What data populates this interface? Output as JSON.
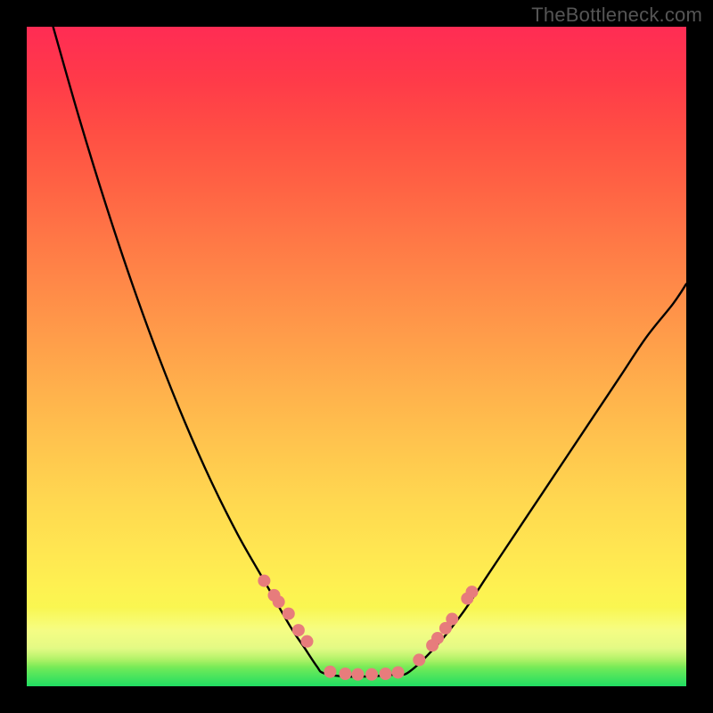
{
  "watermark": "TheBottleneck.com",
  "chart_data": {
    "type": "line",
    "title": "",
    "xlabel": "",
    "ylabel": "",
    "xlim": [
      0,
      100
    ],
    "ylim": [
      0,
      100
    ],
    "grid": false,
    "legend": false,
    "annotations": [],
    "series": [
      {
        "name": "left-curve",
        "x": [
          4,
          8,
          12,
          16,
          20,
          24,
          28,
          32,
          36,
          40,
          42,
          44,
          45
        ],
        "y": [
          100,
          86,
          73,
          61,
          50,
          40,
          31,
          23,
          16,
          9,
          6,
          3,
          2
        ]
      },
      {
        "name": "valley-floor",
        "x": [
          45,
          48,
          52,
          56,
          58
        ],
        "y": [
          2,
          1.5,
          1.5,
          1.8,
          2.2
        ]
      },
      {
        "name": "right-curve",
        "x": [
          58,
          62,
          66,
          70,
          74,
          78,
          82,
          86,
          90,
          94,
          98,
          100
        ],
        "y": [
          2.2,
          6,
          11,
          17,
          23,
          29,
          35,
          41,
          47,
          53,
          58,
          61
        ]
      }
    ],
    "markers": [
      {
        "name": "left-cluster",
        "points": [
          {
            "x": 36.0,
            "y": 16.0
          },
          {
            "x": 37.5,
            "y": 13.8
          },
          {
            "x": 38.2,
            "y": 12.8
          },
          {
            "x": 39.7,
            "y": 11.0
          },
          {
            "x": 41.2,
            "y": 8.5
          },
          {
            "x": 42.5,
            "y": 6.8
          }
        ]
      },
      {
        "name": "floor-cluster",
        "points": [
          {
            "x": 46.0,
            "y": 2.2
          },
          {
            "x": 48.3,
            "y": 1.9
          },
          {
            "x": 50.2,
            "y": 1.8
          },
          {
            "x": 52.3,
            "y": 1.8
          },
          {
            "x": 54.4,
            "y": 1.9
          },
          {
            "x": 56.3,
            "y": 2.1
          }
        ]
      },
      {
        "name": "right-cluster",
        "points": [
          {
            "x": 59.5,
            "y": 4.0
          },
          {
            "x": 61.5,
            "y": 6.2
          },
          {
            "x": 62.3,
            "y": 7.3
          },
          {
            "x": 63.5,
            "y": 8.8
          },
          {
            "x": 64.5,
            "y": 10.2
          },
          {
            "x": 66.8,
            "y": 13.3
          },
          {
            "x": 67.5,
            "y": 14.3
          }
        ]
      }
    ],
    "marker_style": {
      "color": "#e77c7c",
      "radius": 7
    }
  }
}
